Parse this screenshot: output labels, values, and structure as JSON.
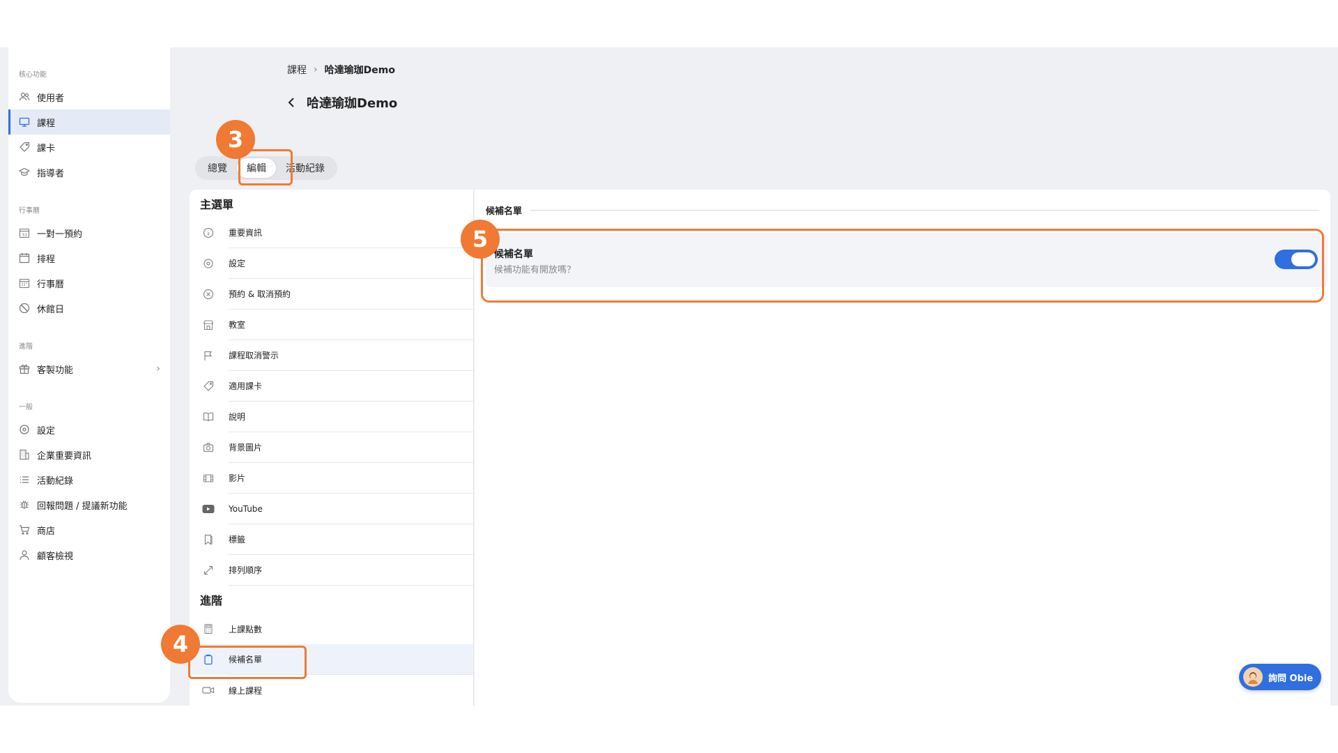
{
  "sidebar": {
    "sections": [
      {
        "title": "核心功能",
        "items": [
          {
            "label": "使用者",
            "icon": "users-icon"
          },
          {
            "label": "課程",
            "icon": "monitor-icon",
            "active": true
          },
          {
            "label": "課卡",
            "icon": "tag-icon"
          },
          {
            "label": "指導者",
            "icon": "graduation-cap-icon"
          }
        ]
      },
      {
        "title": "行事曆",
        "items": [
          {
            "label": "一對一預約",
            "icon": "calendar-31-icon"
          },
          {
            "label": "排程",
            "icon": "calendar-icon"
          },
          {
            "label": "行事曆",
            "icon": "calendar-grid-icon"
          },
          {
            "label": "休館日",
            "icon": "block-icon"
          }
        ]
      },
      {
        "title": "進階",
        "items": [
          {
            "label": "客製功能",
            "icon": "gift-icon"
          }
        ]
      },
      {
        "title": "一般",
        "items": [
          {
            "label": "設定",
            "icon": "gear-icon"
          },
          {
            "label": "企業重要資訊",
            "icon": "building-icon"
          },
          {
            "label": "活動紀錄",
            "icon": "list-icon"
          },
          {
            "label": "回報問題 / 提議新功能",
            "icon": "bug-icon"
          },
          {
            "label": "商店",
            "icon": "cart-icon"
          },
          {
            "label": "顧客檢視",
            "icon": "person-icon"
          }
        ]
      }
    ]
  },
  "breadcrumb": {
    "link": "課程",
    "current": "哈達瑜珈Demo"
  },
  "page": {
    "title": "哈達瑜珈Demo"
  },
  "tabs": {
    "overview": "總覽",
    "edit": "編輯",
    "activity": "活動紀錄"
  },
  "menu": {
    "main_heading": "主選單",
    "main_items": [
      {
        "label": "重要資訊",
        "icon": "info-icon"
      },
      {
        "label": "設定",
        "icon": "gear-icon"
      },
      {
        "label": "預約 & 取消預約",
        "icon": "x-circle-icon"
      },
      {
        "label": "教室",
        "icon": "store-icon"
      },
      {
        "label": "課程取消警示",
        "icon": "flag-icon"
      },
      {
        "label": "適用課卡",
        "icon": "tag-icon"
      },
      {
        "label": "說明",
        "icon": "book-icon"
      },
      {
        "label": "背景圖片",
        "icon": "camera-icon"
      },
      {
        "label": "影片",
        "icon": "film-icon"
      },
      {
        "label": "YouTube",
        "icon": "youtube-icon"
      },
      {
        "label": "標籤",
        "icon": "bookmark-icon"
      },
      {
        "label": "排列順序",
        "icon": "resize-icon"
      }
    ],
    "advanced_heading": "進階",
    "advanced_items": [
      {
        "label": "上課點數",
        "icon": "calculator-icon"
      },
      {
        "label": "候補名單",
        "icon": "clipboard-icon",
        "active": true
      },
      {
        "label": "線上課程",
        "icon": "video-icon"
      }
    ]
  },
  "content": {
    "section_title": "候補名單",
    "setting": {
      "title": "候補名單",
      "description": "候補功能有開放嗎？",
      "enabled": true
    }
  },
  "annotations": {
    "step3": "3",
    "step4": "4",
    "step5": "5"
  },
  "ask_button": {
    "label": "詢問 Obie"
  },
  "colors": {
    "accent": "#2f6fdf",
    "annotation": "#f07a33",
    "background": "#eef0f3"
  }
}
